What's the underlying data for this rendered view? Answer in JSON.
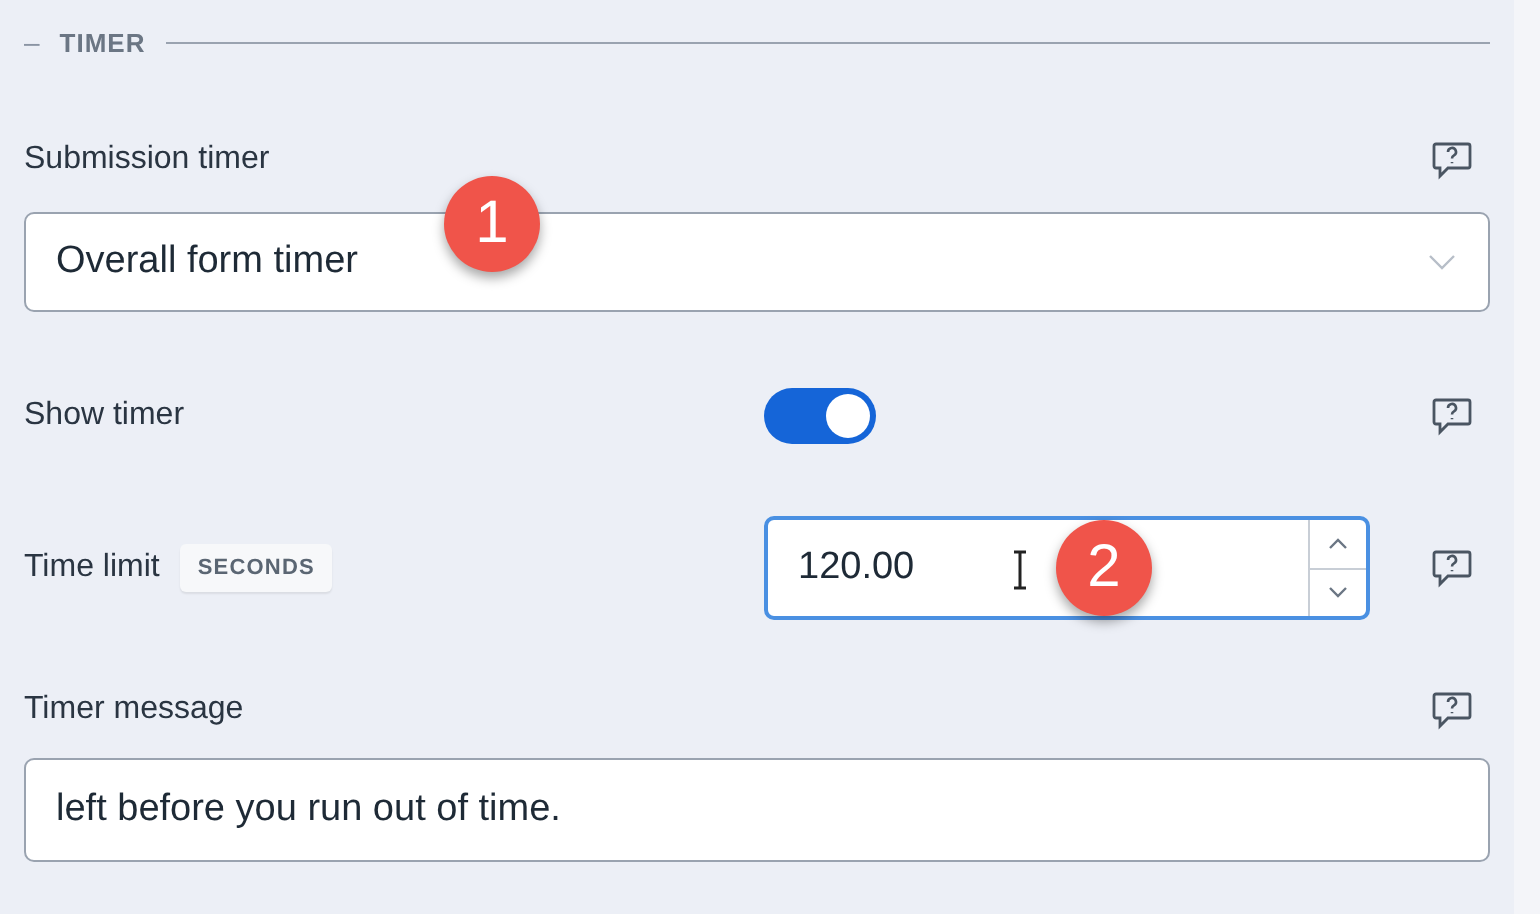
{
  "section": {
    "collapse_glyph": "–",
    "title": "TIMER"
  },
  "fields": [
    {
      "kind": "select",
      "label": "Submission timer",
      "value": "Overall form timer",
      "callout": "1"
    },
    {
      "kind": "toggle",
      "label": "Show timer",
      "on": true
    },
    {
      "kind": "number",
      "label": "Time limit",
      "badge": "SECONDS",
      "value": "120.00",
      "focused": true,
      "callout": "2"
    },
    {
      "kind": "text",
      "label": "Timer message",
      "value": "left before you run out of time."
    }
  ]
}
